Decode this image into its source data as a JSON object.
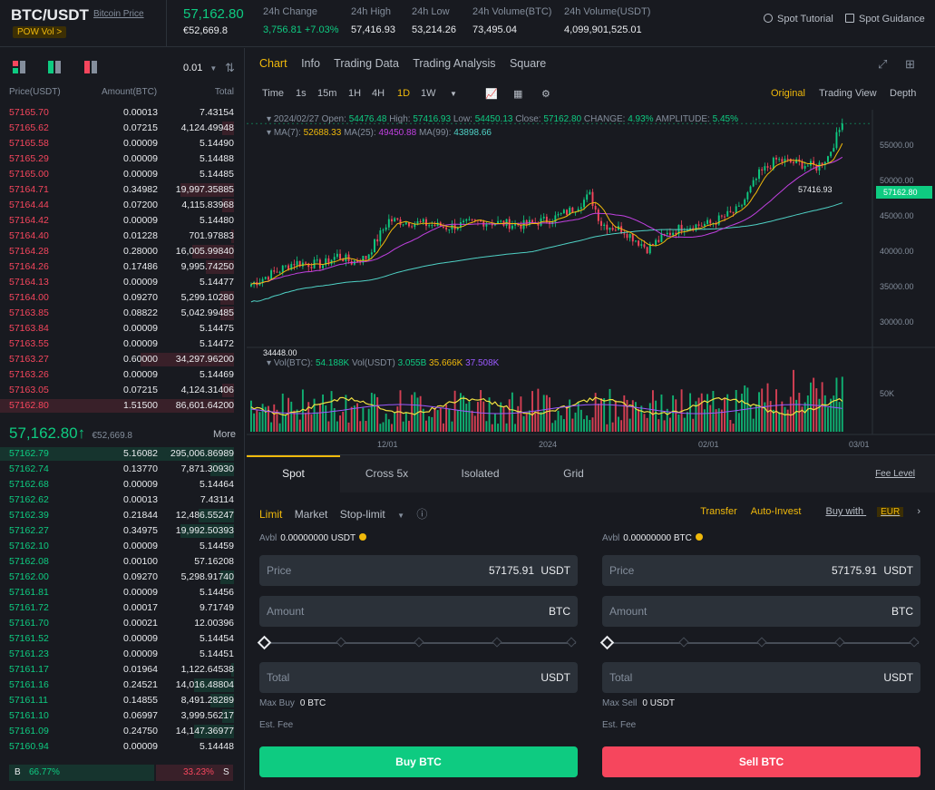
{
  "header": {
    "pair": "BTC/USDT",
    "pair_link": "Bitcoin Price",
    "tag": "POW  Vol >",
    "last_price": "57,162.80",
    "last_price_fiat": "€52,669.8",
    "stats": [
      {
        "label": "24h Change",
        "value": "3,756.81 +7.03%"
      },
      {
        "label": "24h High",
        "value": "57,416.93"
      },
      {
        "label": "24h Low",
        "value": "53,214.26"
      },
      {
        "label": "24h Volume(BTC)",
        "value": "73,495.04"
      },
      {
        "label": "24h Volume(USDT)",
        "value": "4,099,901,525.01"
      }
    ],
    "links": [
      "Spot Tutorial",
      "Spot Guidance"
    ]
  },
  "orderbook": {
    "precision": "0.01",
    "columns": [
      "Price(USDT)",
      "Amount(BTC)",
      "Total"
    ],
    "asks": [
      {
        "price": "57165.70",
        "amount": "0.00013",
        "total": "7.43154",
        "depth": 0.0
      },
      {
        "price": "57165.62",
        "amount": "0.07215",
        "total": "4,124.49948",
        "depth": 0.05
      },
      {
        "price": "57165.58",
        "amount": "0.00009",
        "total": "5.14490",
        "depth": 0.0
      },
      {
        "price": "57165.29",
        "amount": "0.00009",
        "total": "5.14488",
        "depth": 0.0
      },
      {
        "price": "57165.00",
        "amount": "0.00009",
        "total": "5.14485",
        "depth": 0.0
      },
      {
        "price": "57164.71",
        "amount": "0.34982",
        "total": "19,997.35885",
        "depth": 0.23
      },
      {
        "price": "57164.44",
        "amount": "0.07200",
        "total": "4,115.83968",
        "depth": 0.05
      },
      {
        "price": "57164.42",
        "amount": "0.00009",
        "total": "5.14480",
        "depth": 0.0
      },
      {
        "price": "57164.40",
        "amount": "0.01228",
        "total": "701.97883",
        "depth": 0.01
      },
      {
        "price": "57164.28",
        "amount": "0.28000",
        "total": "16,005.99840",
        "depth": 0.18
      },
      {
        "price": "57164.26",
        "amount": "0.17486",
        "total": "9,995.74250",
        "depth": 0.12
      },
      {
        "price": "57164.13",
        "amount": "0.00009",
        "total": "5.14477",
        "depth": 0.0
      },
      {
        "price": "57164.00",
        "amount": "0.09270",
        "total": "5,299.10280",
        "depth": 0.06
      },
      {
        "price": "57163.85",
        "amount": "0.08822",
        "total": "5,042.99485",
        "depth": 0.06
      },
      {
        "price": "57163.84",
        "amount": "0.00009",
        "total": "5.14475",
        "depth": 0.0
      },
      {
        "price": "57163.55",
        "amount": "0.00009",
        "total": "5.14472",
        "depth": 0.0
      },
      {
        "price": "57163.27",
        "amount": "0.60000",
        "total": "34,297.96200",
        "depth": 0.4
      },
      {
        "price": "57163.26",
        "amount": "0.00009",
        "total": "5.14469",
        "depth": 0.0
      },
      {
        "price": "57163.05",
        "amount": "0.07215",
        "total": "4,124.31406",
        "depth": 0.05
      },
      {
        "price": "57162.80",
        "amount": "1.51500",
        "total": "86,601.64200",
        "depth": 1.0
      }
    ],
    "mid_price": "57,162.80",
    "mid_arrow": "↑",
    "mid_fiat": "€52,669.8",
    "more": "More",
    "bids": [
      {
        "price": "57162.79",
        "amount": "5.16082",
        "total": "295,006.86989",
        "depth": 1.0
      },
      {
        "price": "57162.74",
        "amount": "0.13770",
        "total": "7,871.30930",
        "depth": 0.1
      },
      {
        "price": "57162.68",
        "amount": "0.00009",
        "total": "5.14464",
        "depth": 0.0
      },
      {
        "price": "57162.62",
        "amount": "0.00013",
        "total": "7.43114",
        "depth": 0.0
      },
      {
        "price": "57162.39",
        "amount": "0.21844",
        "total": "12,486.55247",
        "depth": 0.15
      },
      {
        "price": "57162.27",
        "amount": "0.34975",
        "total": "19,992.50393",
        "depth": 0.23
      },
      {
        "price": "57162.10",
        "amount": "0.00009",
        "total": "5.14459",
        "depth": 0.0
      },
      {
        "price": "57162.08",
        "amount": "0.00100",
        "total": "57.16208",
        "depth": 0.0
      },
      {
        "price": "57162.00",
        "amount": "0.09270",
        "total": "5,298.91740",
        "depth": 0.06
      },
      {
        "price": "57161.81",
        "amount": "0.00009",
        "total": "5.14456",
        "depth": 0.0
      },
      {
        "price": "57161.72",
        "amount": "0.00017",
        "total": "9.71749",
        "depth": 0.0
      },
      {
        "price": "57161.70",
        "amount": "0.00021",
        "total": "12.00396",
        "depth": 0.0
      },
      {
        "price": "57161.52",
        "amount": "0.00009",
        "total": "5.14454",
        "depth": 0.0
      },
      {
        "price": "57161.23",
        "amount": "0.00009",
        "total": "5.14451",
        "depth": 0.0
      },
      {
        "price": "57161.17",
        "amount": "0.01964",
        "total": "1,122.64538",
        "depth": 0.01
      },
      {
        "price": "57161.16",
        "amount": "0.24521",
        "total": "14,016.48804",
        "depth": 0.17
      },
      {
        "price": "57161.11",
        "amount": "0.14855",
        "total": "8,491.28289",
        "depth": 0.1
      },
      {
        "price": "57161.10",
        "amount": "0.06997",
        "total": "3,999.56217",
        "depth": 0.05
      },
      {
        "price": "57161.09",
        "amount": "0.24750",
        "total": "14,147.36977",
        "depth": 0.17
      },
      {
        "price": "57160.94",
        "amount": "0.00009",
        "total": "5.14448",
        "depth": 0.0
      }
    ],
    "ratio": {
      "buy_label": "B",
      "buy": "66.77%",
      "sell": "33.23%",
      "sell_label": "S"
    }
  },
  "chart": {
    "tabs": [
      "Chart",
      "Info",
      "Trading Data",
      "Trading Analysis",
      "Square"
    ],
    "active_tab": "Chart",
    "intervals": [
      "Time",
      "1s",
      "15m",
      "1H",
      "4H",
      "1D",
      "1W"
    ],
    "active_interval": "1D",
    "views": [
      "Original",
      "Trading View",
      "Depth"
    ],
    "active_view": "Original",
    "ohlc": {
      "date": "2024/02/27",
      "open_label": "Open:",
      "open": "54476.48",
      "high_label": "High:",
      "high": "57416.93",
      "low_label": "Low:",
      "low": "54450.13",
      "close_label": "Close:",
      "close": "57162.80",
      "change_label": "CHANGE:",
      "change": "4.93%",
      "amp_label": "AMPLITUDE:",
      "amplitude": "5.45%"
    },
    "ma": {
      "ma7_label": "MA(7):",
      "ma7": "52688.33",
      "ma25_label": "MA(25):",
      "ma25": "49450.88",
      "ma99_label": "MA(99):",
      "ma99": "43898.66"
    },
    "vol": {
      "btc_label": "Vol(BTC):",
      "btc": "54.188K",
      "usdt_label": "Vol(USDT)",
      "usdt": "3.055B",
      "v1": "35.666K",
      "v2": "37.508K"
    },
    "price_axis": [
      "55000.00",
      "50000.00",
      "45000.00",
      "40000.00",
      "35000.00",
      "30000.00"
    ],
    "vol_axis": [
      "50K"
    ],
    "time_axis": [
      "12/01",
      "2024",
      "02/01",
      "03/01"
    ],
    "current_price_tag": "57162.80",
    "high_marker": "57416.93",
    "low_marker": "34448.00",
    "colors": {
      "up": "#0ecb81",
      "down": "#f6465d",
      "ma7": "#f0b90b",
      "ma25": "#c040e0",
      "ma99": "#4fd1c5",
      "accent": "#f0b90b"
    }
  },
  "trade": {
    "tabs": [
      "Spot",
      "Cross 5x",
      "Isolated",
      "Grid"
    ],
    "active_tab": "Spot",
    "fee_level": "Fee Level",
    "order_types": [
      "Limit",
      "Market",
      "Stop-limit"
    ],
    "active_order_type": "Limit",
    "right_links": {
      "transfer": "Transfer",
      "auto_invest": "Auto-Invest",
      "buy_with": "Buy with",
      "currency": "EUR"
    },
    "buy": {
      "avbl_label": "Avbl",
      "avbl": "0.00000000 USDT",
      "price_label": "Price",
      "price": "57175.91",
      "price_unit": "USDT",
      "amount_label": "Amount",
      "amount_unit": "BTC",
      "total_label": "Total",
      "total_unit": "USDT",
      "max_label": "Max Buy",
      "max": "0 BTC",
      "fee_label": "Est. Fee",
      "button": "Buy BTC"
    },
    "sell": {
      "avbl_label": "Avbl",
      "avbl": "0.00000000 BTC",
      "price_label": "Price",
      "price": "57175.91",
      "price_unit": "USDT",
      "amount_label": "Amount",
      "amount_unit": "BTC",
      "total_label": "Total",
      "total_unit": "USDT",
      "max_label": "Max Sell",
      "max": "0 USDT",
      "fee_label": "Est. Fee",
      "button": "Sell BTC"
    }
  }
}
